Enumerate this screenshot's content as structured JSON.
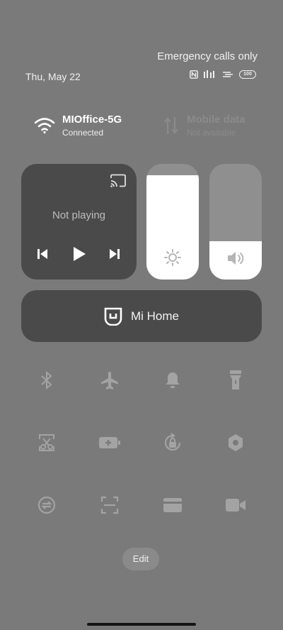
{
  "status": {
    "emergency_text": "Emergency calls only",
    "date": "Thu, May 22",
    "battery": "100"
  },
  "network": {
    "wifi": {
      "name": "MIOffice-5G",
      "status": "Connected"
    },
    "mobile": {
      "name": "Mobile data",
      "status": "Not available"
    }
  },
  "media": {
    "title": "Not playing"
  },
  "sliders": {
    "brightness_level": 0.9,
    "volume_level": 0.33
  },
  "mihome": {
    "label": "Mi Home"
  },
  "toggles": {
    "row1": [
      "bluetooth-icon",
      "airplane-icon",
      "bell-icon",
      "flashlight-icon"
    ],
    "row2": [
      "screenshot-icon",
      "battery-saver-icon",
      "rotation-lock-icon",
      "settings-icon"
    ],
    "row3": [
      "sync-icon",
      "scanner-icon",
      "card-icon",
      "video-camera-icon"
    ]
  },
  "edit_label": "Edit"
}
